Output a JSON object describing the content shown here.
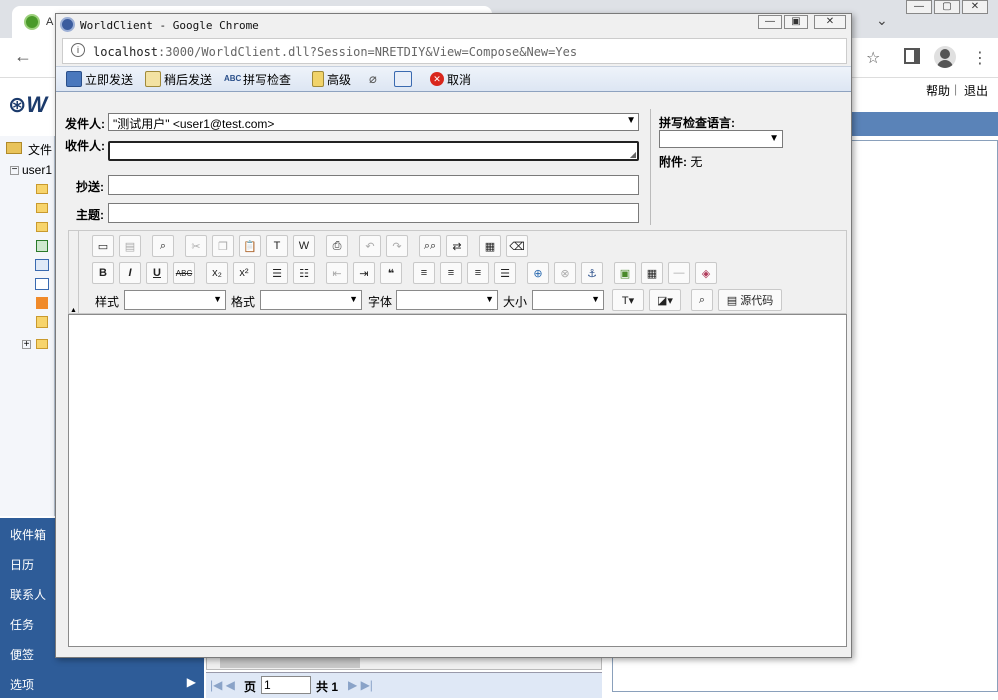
{
  "bg": {
    "tab_title": "A",
    "help_label": "帮助",
    "logout_label": "退出",
    "folders_label": "文件",
    "user_label": "user1",
    "bottom_nav": [
      "收件箱",
      "日历",
      "联系人",
      "任务",
      "便签",
      "选项"
    ],
    "pager": {
      "page_label": "页",
      "page_value": "1",
      "total_label": "共 1"
    }
  },
  "popup": {
    "window_title": "WorldClient - Google Chrome",
    "url_host": "localhost",
    "url_rest": ":3000/WorldClient.dll?Session=NRETDIY&View=Compose&New=Yes"
  },
  "toolbar": {
    "send_now": "立即发送",
    "send_later": "稍后发送",
    "spell_check": "拼写检查",
    "advanced": "高级",
    "cancel": "取消"
  },
  "compose": {
    "from_label": "发件人:",
    "from_value": "\"测试用户\" <user1@test.com>",
    "to_label": "收件人:",
    "to_value": "",
    "cc_label": "抄送:",
    "cc_value": "",
    "subject_label": "主题:",
    "subject_value": "",
    "spell_lang_label": "拼写检查语言:",
    "spell_lang_value": "",
    "attachment_label": "附件:",
    "attachment_value": "无"
  },
  "editor": {
    "style_label": "样式",
    "format_label": "格式",
    "font_label": "字体",
    "size_label": "大小",
    "source_label": "源代码",
    "body": ""
  },
  "colors": {
    "toolbar_border": "#8ea2bf",
    "bottom_nav_bg": "#2e5c98",
    "cancel_red": "#d9261c"
  }
}
